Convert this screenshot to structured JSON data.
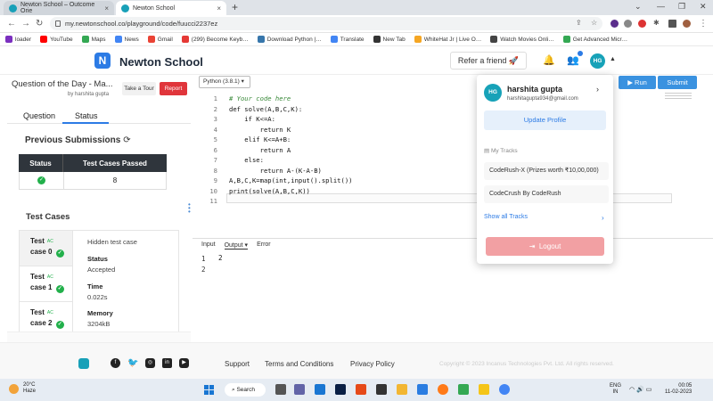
{
  "browser": {
    "tabs": [
      {
        "label": "Newton School – Outcome Orie"
      },
      {
        "label": "Newton School"
      }
    ],
    "new_tab": "+",
    "url": "my.newtonschool.co/playground/code/fuucci2237ez",
    "bookmarks": [
      {
        "label": "loader",
        "color": "#7b2fbf"
      },
      {
        "label": "YouTube",
        "color": "#ff0000"
      },
      {
        "label": "Maps",
        "color": "#34a853"
      },
      {
        "label": "News",
        "color": "#4285f4"
      },
      {
        "label": "Gmail",
        "color": "#ea4335"
      },
      {
        "label": "(299) Become Keyb…",
        "color": "#e53935"
      },
      {
        "label": "Download Python |…",
        "color": "#3776ab"
      },
      {
        "label": "Translate",
        "color": "#4285f4"
      },
      {
        "label": "New Tab",
        "color": "#333333"
      },
      {
        "label": "WhiteHat Jr | Live O…",
        "color": "#f5a623"
      },
      {
        "label": "Watch Movies Onli…",
        "color": "#444444"
      },
      {
        "label": "Get Advanced Micr…",
        "color": "#34a853"
      }
    ]
  },
  "header": {
    "logo_letter": "N",
    "brand": "Newton School",
    "refer": "Refer a friend 🚀",
    "avatar": "HG"
  },
  "question": {
    "title": "Question of the Day - Ma...",
    "author": "by harshita gupta",
    "take_tour": "Take a Tour",
    "report": "Report",
    "tab_question": "Question",
    "tab_status": "Status"
  },
  "submissions": {
    "title": "Previous Submissions",
    "col_status": "Status",
    "col_passed": "Test Cases Passed",
    "rows": [
      {
        "passed": "8"
      }
    ]
  },
  "testcases": {
    "title": "Test Cases",
    "items": [
      {
        "label": "Test",
        "label2": "case 0",
        "badge": "AC"
      },
      {
        "label": "Test",
        "label2": "case 1",
        "badge": "AC"
      },
      {
        "label": "Test",
        "label2": "case 2",
        "badge": "AC"
      }
    ],
    "detail": {
      "hidden": "Hidden test case",
      "status_label": "Status",
      "status_value": "Accepted",
      "time_label": "Time",
      "time_value": "0.022s",
      "memory_label": "Memory",
      "memory_value": "3204kB"
    }
  },
  "editor": {
    "language": "Python (3.8.1) ▾",
    "run": "▶ Run",
    "submit": "Submit",
    "lines": [
      {
        "n": "1",
        "text": "# Your code here"
      },
      {
        "n": "2",
        "text": "def solve(A,B,C,K):"
      },
      {
        "n": "3",
        "text": "    if K<=A:"
      },
      {
        "n": "4",
        "text": "        return K"
      },
      {
        "n": "5",
        "text": "    elif K<=A+B:"
      },
      {
        "n": "6",
        "text": "        return A"
      },
      {
        "n": "7",
        "text": "    else:"
      },
      {
        "n": "8",
        "text": "        return A-(K-A-B)"
      },
      {
        "n": "9",
        "text": "A,B,C,K=map(int,input().split())"
      },
      {
        "n": "10",
        "text": "print(solve(A,B,C,K))"
      },
      {
        "n": "11",
        "text": ""
      }
    ],
    "io_tabs": {
      "input": "Input",
      "output": "Output ▾",
      "error": "Error"
    },
    "output_lines": [
      "1",
      "2"
    ],
    "output_value": "2"
  },
  "profile_menu": {
    "avatar": "HG",
    "name": "harshita gupta",
    "email": "harshitagupta934@gmail.com",
    "update_profile": "Update Profile",
    "my_tracks": "My Tracks",
    "tracks": [
      "CodeRush-X (Prizes worth ₹10,00,000)",
      "CodeCrush By CodeRush"
    ],
    "show_all": "Show all Tracks",
    "logout": "Logout"
  },
  "footer": {
    "links": [
      "Support",
      "Terms and Conditions",
      "Privacy Policy"
    ],
    "copyright": "Copyright © 2023 Incanus Technologies Pvt. Ltd. All rights reserved."
  },
  "taskbar": {
    "temp": "20°C",
    "weather": "Haze",
    "search": "Search",
    "lang1": "ENG",
    "lang2": "IN",
    "time": "00:05",
    "date": "11-02-2023"
  }
}
